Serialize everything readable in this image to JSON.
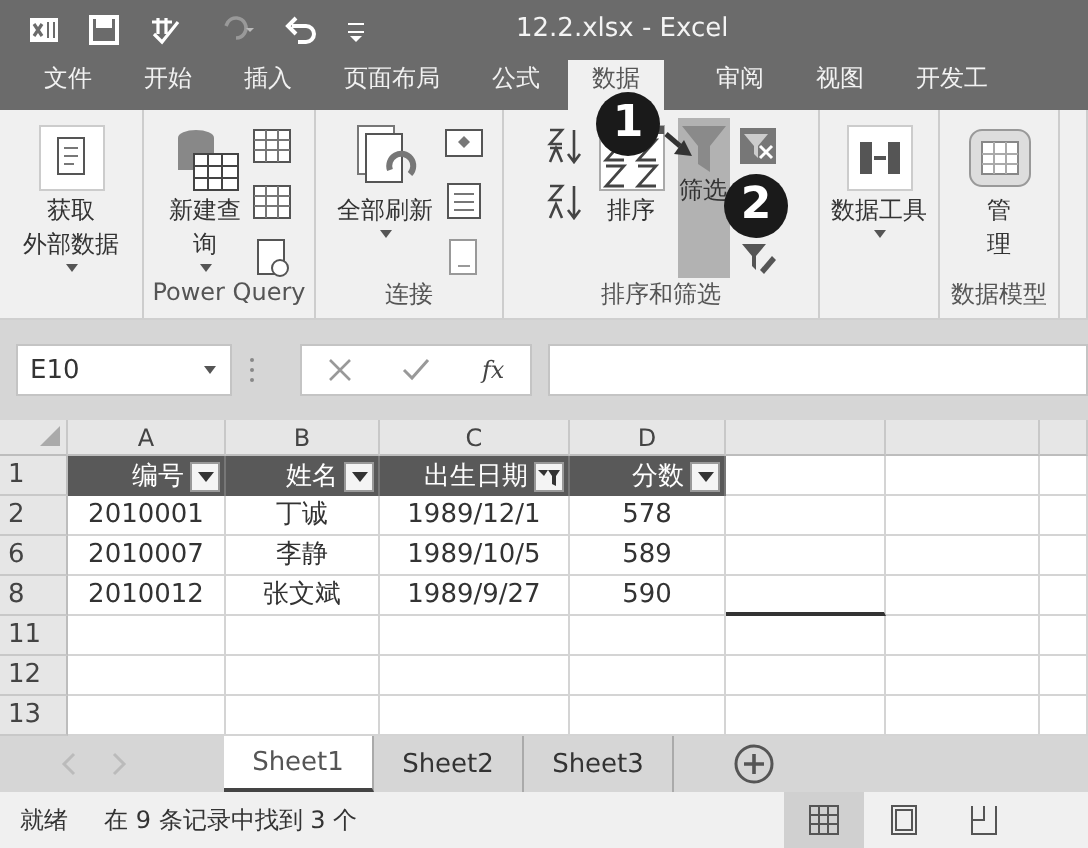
{
  "title_bar": {
    "title": "12.2.xlsx - Excel"
  },
  "ribbon_tabs": [
    {
      "label": "文件",
      "selected": false
    },
    {
      "label": "开始",
      "selected": false
    },
    {
      "label": "插入",
      "selected": false
    },
    {
      "label": "页面布局",
      "selected": false
    },
    {
      "label": "公式",
      "selected": false
    },
    {
      "label": "数据",
      "selected": true
    },
    {
      "label": "审阅",
      "selected": false
    },
    {
      "label": "视图",
      "selected": false
    },
    {
      "label": "开发工",
      "selected": false
    }
  ],
  "ribbon_groups": [
    {
      "commands": [
        {
          "lines": [
            "获取",
            "外部数据"
          ],
          "selected": false
        }
      ]
    },
    {
      "label": "Power Query",
      "commands": [
        {
          "lines": [
            "新建查",
            "询"
          ],
          "selected": false
        }
      ]
    },
    {
      "label": "连接",
      "commands": [
        {
          "lines": [
            "全部刷新"
          ],
          "selected": false
        }
      ]
    },
    {
      "label": "排序和筛选",
      "commands": [
        {
          "lines": [
            "排序"
          ],
          "selected": false
        },
        {
          "lines": [
            "筛选"
          ],
          "selected": true
        }
      ]
    },
    {
      "commands": [
        {
          "lines": [
            "数据工具"
          ],
          "selected": false
        }
      ]
    },
    {
      "label": "数据模型",
      "commands": [
        {
          "lines": [
            "管",
            "理"
          ],
          "selected": false
        }
      ]
    }
  ],
  "callouts": [
    {
      "text": "1"
    },
    {
      "text": "2"
    }
  ],
  "formula_bar": {
    "name_box": "E10",
    "fx": "fx"
  },
  "sheet": {
    "columns": [
      "A",
      "B",
      "C",
      "D"
    ],
    "header_row": {
      "number": "1",
      "cells": [
        {
          "text": "编号",
          "filtered": false
        },
        {
          "text": "姓名",
          "filtered": false
        },
        {
          "text": "出生日期",
          "filtered": true
        },
        {
          "text": "分数",
          "filtered": false
        }
      ]
    },
    "rows": [
      {
        "number": "2",
        "cells": [
          "2010001",
          "丁诚",
          "1989/12/1",
          "578"
        ]
      },
      {
        "number": "6",
        "cells": [
          "2010007",
          "李静",
          "1989/10/5",
          "589"
        ]
      },
      {
        "number": "8",
        "cells": [
          "2010012",
          "张文斌",
          "1989/9/27",
          "590"
        ]
      },
      {
        "number": "11",
        "cells": []
      },
      {
        "number": "12",
        "cells": []
      },
      {
        "number": "13",
        "cells": []
      }
    ]
  },
  "sheet_tabs": [
    {
      "label": "Sheet1",
      "selected": true
    },
    {
      "label": "Sheet2",
      "selected": false
    },
    {
      "label": "Sheet3",
      "selected": false
    }
  ],
  "status_bar": {
    "mode": "就绪",
    "message": "在 9 条记录中找到 3 个",
    "views": [
      {
        "selected": true
      },
      {
        "selected": false
      },
      {
        "selected": false
      }
    ]
  }
}
